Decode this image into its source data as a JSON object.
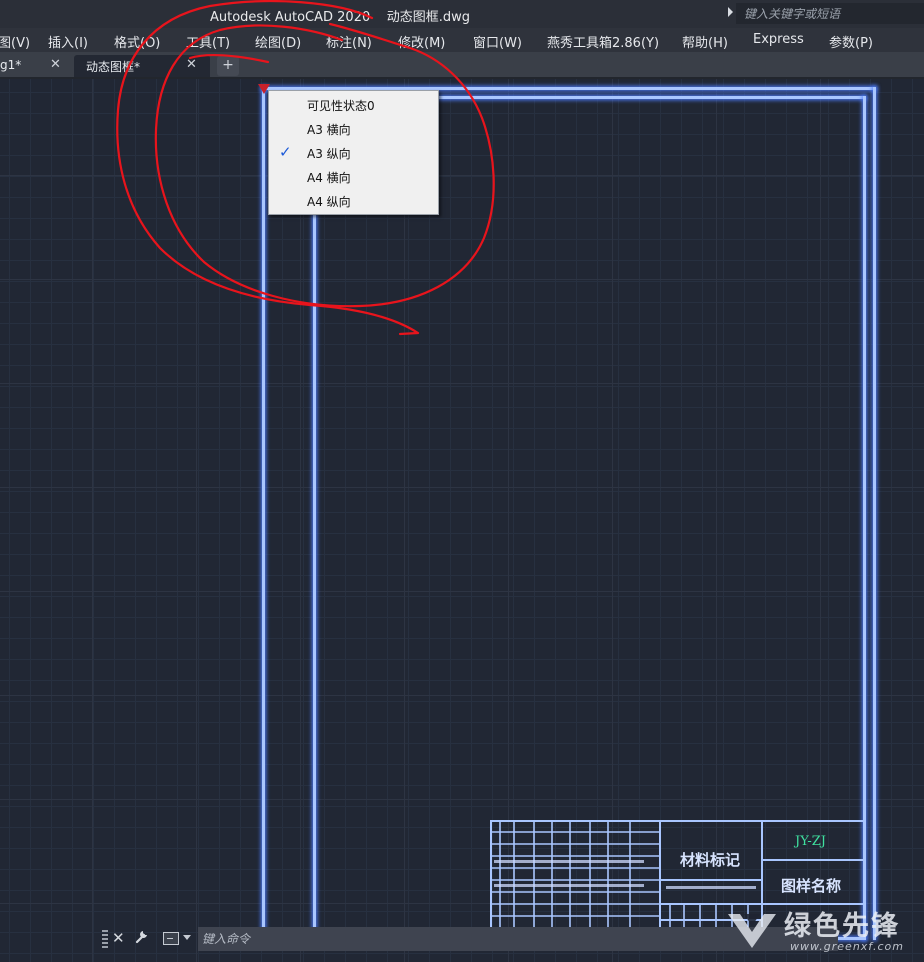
{
  "app": {
    "title": "Autodesk AutoCAD 2020    动态图框.dwg",
    "search_placeholder": "键入关键字或短语"
  },
  "menubar": {
    "items": [
      "图(V)",
      "插入(I)",
      "格式(O)",
      "工具(T)",
      "绘图(D)",
      "标注(N)",
      "修改(M)",
      "窗口(W)",
      "燕秀工具箱2.86(Y)",
      "帮助(H)",
      "Express",
      "参数(P)"
    ]
  },
  "tabs": {
    "items": [
      {
        "label": "g1*",
        "close": "✕"
      },
      {
        "label": "动态图框*",
        "close": "✕"
      }
    ],
    "add": "+"
  },
  "visibility_menu": {
    "items": [
      {
        "label": "可见性状态0",
        "checked": false
      },
      {
        "label": "A3 横向",
        "checked": false
      },
      {
        "label": "A3 纵向",
        "checked": true
      },
      {
        "label": "A4 横向",
        "checked": false
      },
      {
        "label": "A4 纵向",
        "checked": false
      }
    ],
    "check_mark": "✓"
  },
  "title_block": {
    "material_label": "材料标记",
    "drawing_name": "图样名称",
    "code": "JY-ZJ"
  },
  "command_line": {
    "placeholder": "键入命令",
    "close": "✕",
    "settings_icon": "wrench-icon"
  },
  "watermark": {
    "name": "绿色先锋",
    "url": "www.greenxf.com"
  },
  "colors": {
    "background": "#212734",
    "frame_line": "#a9c6ff",
    "annotation": "#e8141c",
    "code_text": "#3fe0a0"
  }
}
